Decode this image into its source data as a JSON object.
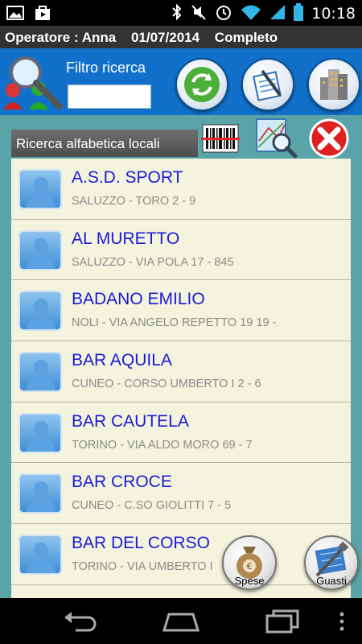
{
  "status_bar": {
    "time": "10:18"
  },
  "operator_bar": {
    "operator": "Operatore : Anna",
    "date": "01/07/2014",
    "status": "Completo"
  },
  "header": {
    "filter_label": "Filtro ricerca",
    "filter_value": ""
  },
  "list": {
    "title": "Ricerca alfabetica locali",
    "items": [
      {
        "name": "A.S.D. SPORT",
        "address": "SALUZZO - TORO 2 - 9"
      },
      {
        "name": "AL MURETTO",
        "address": "SALUZZO - VIA POLA 17 - 845"
      },
      {
        "name": "BADANO EMILIO",
        "address": "NOLI - VIA ANGELO REPETTO 19 19 -"
      },
      {
        "name": "BAR AQUILA",
        "address": "CUNEO - CORSO UMBERTO I 2 - 6"
      },
      {
        "name": "BAR CAUTELA",
        "address": "TORINO - VIA ALDO MORO 69 - 7"
      },
      {
        "name": "BAR CROCE",
        "address": "CUNEO - C.SO GIOLITTI 7 - 5"
      },
      {
        "name": "BAR DEL CORSO",
        "address": "TORINO - VIA UMBERTO I"
      }
    ]
  },
  "fabs": {
    "spese": "Spese",
    "guasti": "Guasti"
  },
  "colors": {
    "header_blue": "#1170c9",
    "panel_teal": "#5aa3a8",
    "list_bg": "#f4f4de",
    "item_name": "#1a1ad6"
  }
}
